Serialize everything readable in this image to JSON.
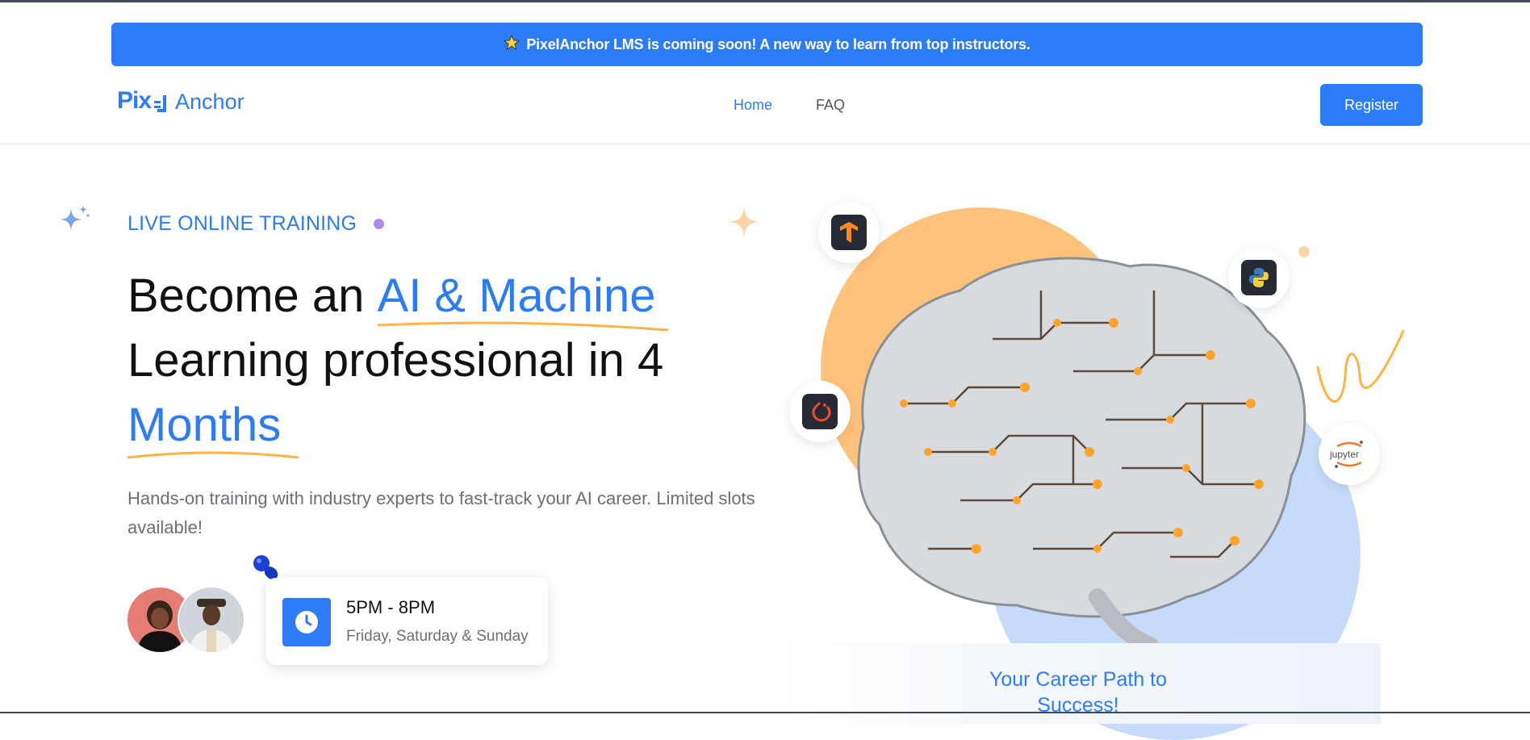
{
  "banner": {
    "icon": "star-badge-icon",
    "text": "PixelAnchor LMS is coming soon! A new way to learn from top instructors."
  },
  "header": {
    "logo_primary": "Pix",
    "logo_secondary": "Anchor",
    "nav": [
      {
        "label": "Home",
        "active": true
      },
      {
        "label": "FAQ",
        "active": false
      }
    ],
    "register_label": "Register"
  },
  "hero": {
    "eyebrow": "LIVE ONLINE TRAINING",
    "headline": {
      "line1_plain": "Become an ",
      "line1_accent": "AI & Machine",
      "line2": "Learning professional in 4",
      "line3_accent": "Months"
    },
    "subtext": "Hands-on training with industry experts to fast-track your AI career. Limited slots available!",
    "schedule": {
      "time": "5PM - 8PM",
      "days": "Friday, Saturday & Sunday"
    }
  },
  "visual": {
    "tools": [
      "tensorflow-icon",
      "python-icon",
      "pytorch-icon",
      "jupyter-icon"
    ],
    "jupyter_label": "jupyter",
    "career_path": "Your Career Path to Success!"
  },
  "colors": {
    "brand_blue": "#2b7cf6",
    "accent_orange": "#ffc27a",
    "light_blue": "#c6dbfb",
    "purple_dot": "#b08ae8"
  }
}
